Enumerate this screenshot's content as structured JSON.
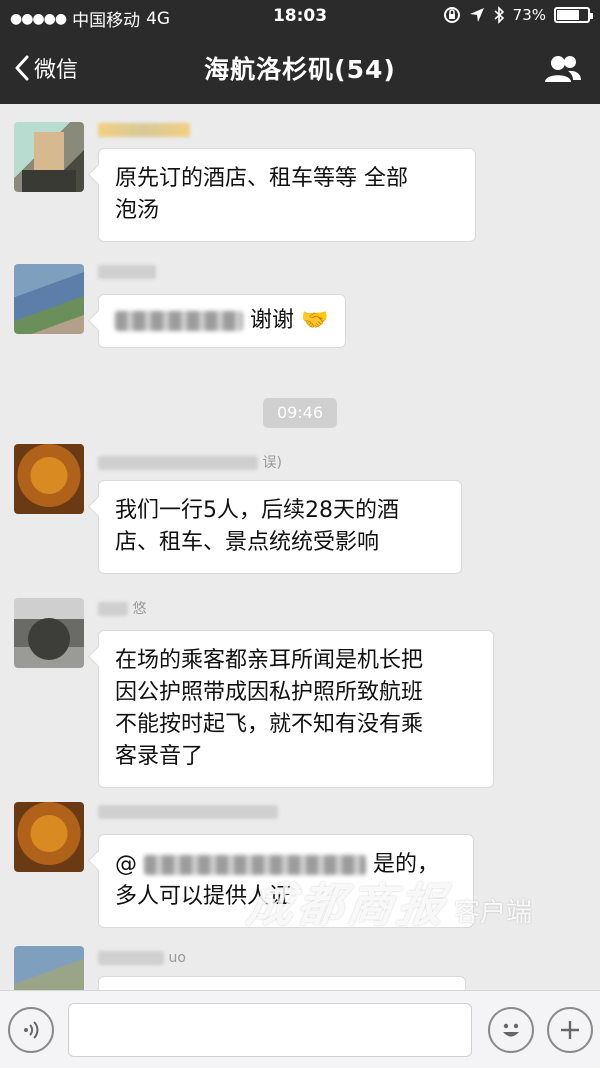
{
  "status_bar": {
    "carrier": "中国移动",
    "network": "4G",
    "time": "18:03",
    "battery": "73%",
    "battery_level": 0.73
  },
  "nav": {
    "back_label": "微信",
    "title": "海航洛杉矶(54)"
  },
  "messages": [
    {
      "sender": "",
      "lines": [
        "原先订的酒店、租车等等 全部",
        "泡汤"
      ]
    },
    {
      "sender": "",
      "text_suffix": "谢谢",
      "emoji": "🤝"
    },
    {
      "sender": "误)",
      "lines": [
        "我们一行5人，后续28天的酒",
        "店、租车、景点统统受影响"
      ]
    },
    {
      "sender": "悠",
      "lines": [
        "在场的乘客都亲耳所闻是机长把",
        "因公护照带成因私护照所致航班",
        "不能按时起飞，就不知有没有乘",
        "客录音了"
      ]
    },
    {
      "sender": "",
      "line1_prefix": "@",
      "line1_suffix": "是的，",
      "line2": "多人可以提供人证"
    },
    {
      "sender": "uo"
    }
  ],
  "timestamp": "09:46",
  "watermark": {
    "main": "成都商报",
    "sub": "客户端"
  },
  "input_bar": {
    "placeholder": ""
  },
  "icons": {
    "back": "chevron-left-icon",
    "members": "group-members-icon",
    "voice": "voice-icon",
    "emoji": "emoji-icon",
    "plus": "plus-icon"
  }
}
